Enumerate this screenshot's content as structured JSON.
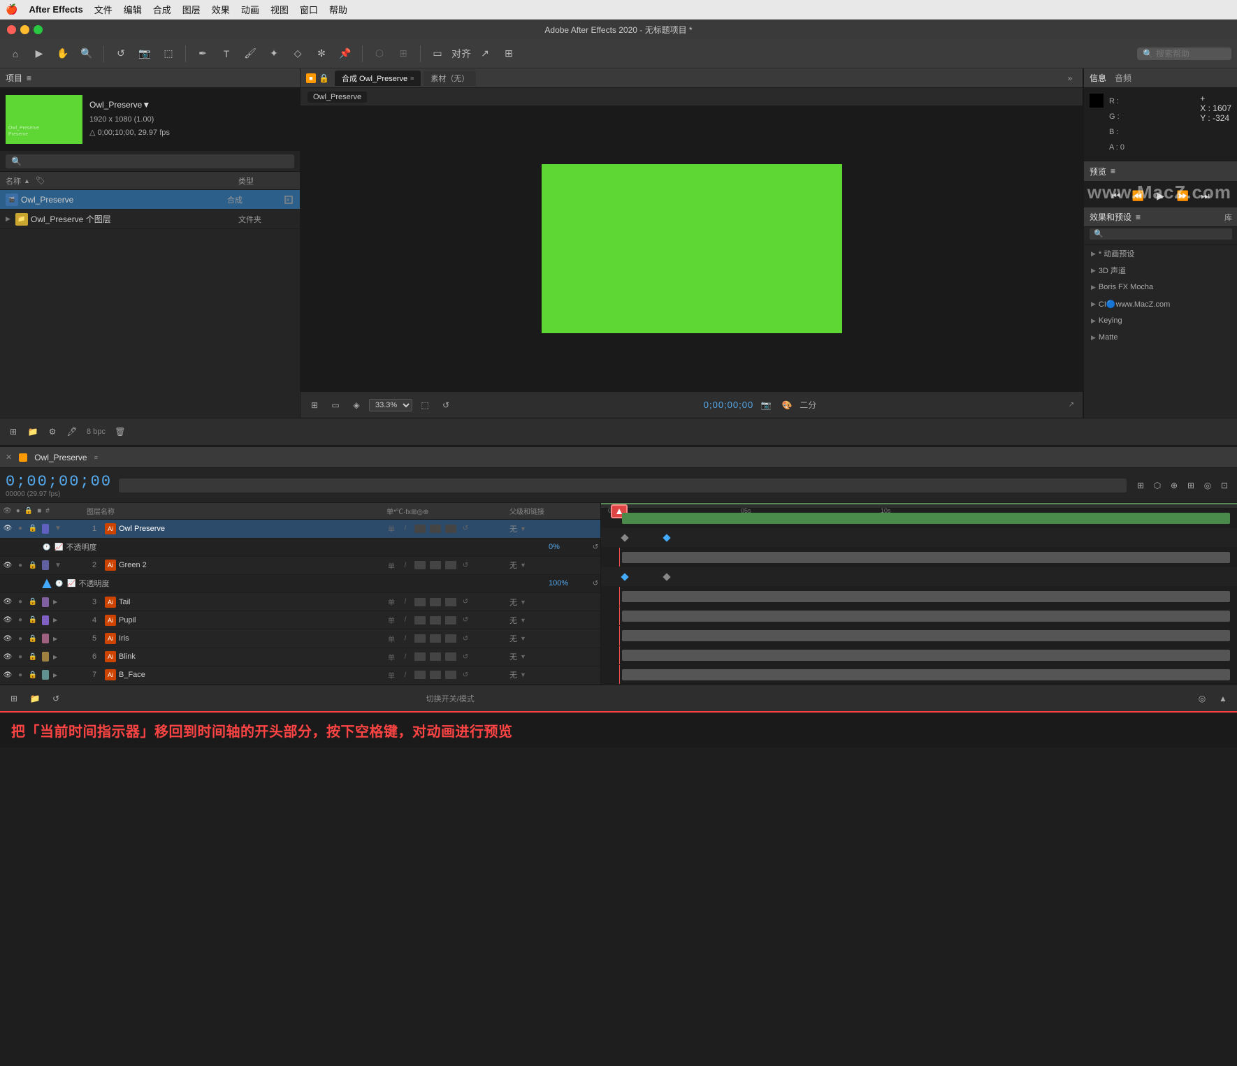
{
  "menubar": {
    "apple": "🍎",
    "app_name": "After Effects",
    "items": [
      "文件",
      "编辑",
      "合成",
      "图层",
      "效果",
      "动画",
      "视图",
      "窗口",
      "帮助"
    ]
  },
  "titlebar": {
    "title": "Adobe After Effects 2020 - 无标题项目 *"
  },
  "toolbar": {
    "search_placeholder": "搜索帮助"
  },
  "project_panel": {
    "title": "项目",
    "menu_icon": "≡",
    "preview_name": "Owl_Preserve▼",
    "preview_info1": "1920 x 1080 (1.00)",
    "preview_info2": "△ 0;00;10;00, 29.97 fps",
    "search_placeholder": "",
    "col_name": "名称",
    "col_type": "类型",
    "items": [
      {
        "name": "Owl_Preserve",
        "type": "合成",
        "icon": "comp"
      },
      {
        "name": "Owl_Preserve 个图层",
        "type": "文件夹",
        "icon": "folder"
      }
    ]
  },
  "composition_panel": {
    "tabs": [
      "合成 Owl_Preserve",
      "素材（无）"
    ],
    "active_tab": "合成 Owl_Preserve",
    "sub_tab": "Owl_Preserve",
    "magnify": "33.3%",
    "timecode": "0;00;00;00",
    "quality": "二分"
  },
  "info_panel": {
    "title_info": "信息",
    "title_audio": "音频",
    "r_label": "R :",
    "g_label": "G :",
    "b_label": "B :",
    "a_label": "A : 0",
    "x_label": "X : 1607",
    "y_label": "Y : -324",
    "plus_label": "+"
  },
  "preview_panel": {
    "title": "预览",
    "menu_icon": "≡"
  },
  "effects_panel": {
    "title": "效果和预设",
    "menu_icon": "≡",
    "library_tab": "库",
    "search_placeholder": "🔍",
    "items": [
      {
        "name": "* 动画预设"
      },
      {
        "name": "3D 声道"
      },
      {
        "name": "Boris FX Mocha"
      },
      {
        "name": "CI🔵www.MacZ.com"
      },
      {
        "name": "Keying"
      },
      {
        "name": "Matte"
      }
    ]
  },
  "timeline": {
    "comp_name": "Owl_Preserve",
    "timecode": "0;00;00;00",
    "fps_label": "00000 (29.97 fps)",
    "search_placeholder": "",
    "col_layer_name": "图层名称",
    "col_parent": "父级和链接",
    "col_options": "单*℃·fx⊞◎⊕",
    "layers": [
      {
        "num": 1,
        "name": "Owl Preserve",
        "color": "#6060c0",
        "type": "ai",
        "parent": "无",
        "expanded": true,
        "selected": true
      },
      {
        "num": "",
        "name": "不透明度",
        "value": "0%",
        "sub": true,
        "is_opacity": true
      },
      {
        "num": 2,
        "name": "Green 2",
        "color": "#6060a0",
        "type": "ai",
        "parent": "无",
        "expanded": true
      },
      {
        "num": "",
        "name": "不透明度",
        "value": "100%",
        "sub": true,
        "is_opacity": true
      },
      {
        "num": 3,
        "name": "Tail",
        "color": "#8060a0",
        "type": "ai",
        "parent": "无"
      },
      {
        "num": 4,
        "name": "Pupil",
        "color": "#8060c0",
        "type": "ai",
        "parent": "无"
      },
      {
        "num": 5,
        "name": "Iris",
        "color": "#a06080",
        "type": "ai",
        "parent": "无"
      },
      {
        "num": 6,
        "name": "Blink",
        "color": "#a08040",
        "type": "ai",
        "parent": "无"
      },
      {
        "num": 7,
        "name": "B_Face",
        "color": "#609090",
        "type": "ai",
        "parent": "无"
      }
    ]
  },
  "bottom_toolbar": {
    "label": "切换开关/模式"
  },
  "instruction": {
    "text": "把「当前时间指示器」移回到时间轴的开头部分，按下空格键，对动画进行预览"
  },
  "watermark": "www.MacZ.com"
}
